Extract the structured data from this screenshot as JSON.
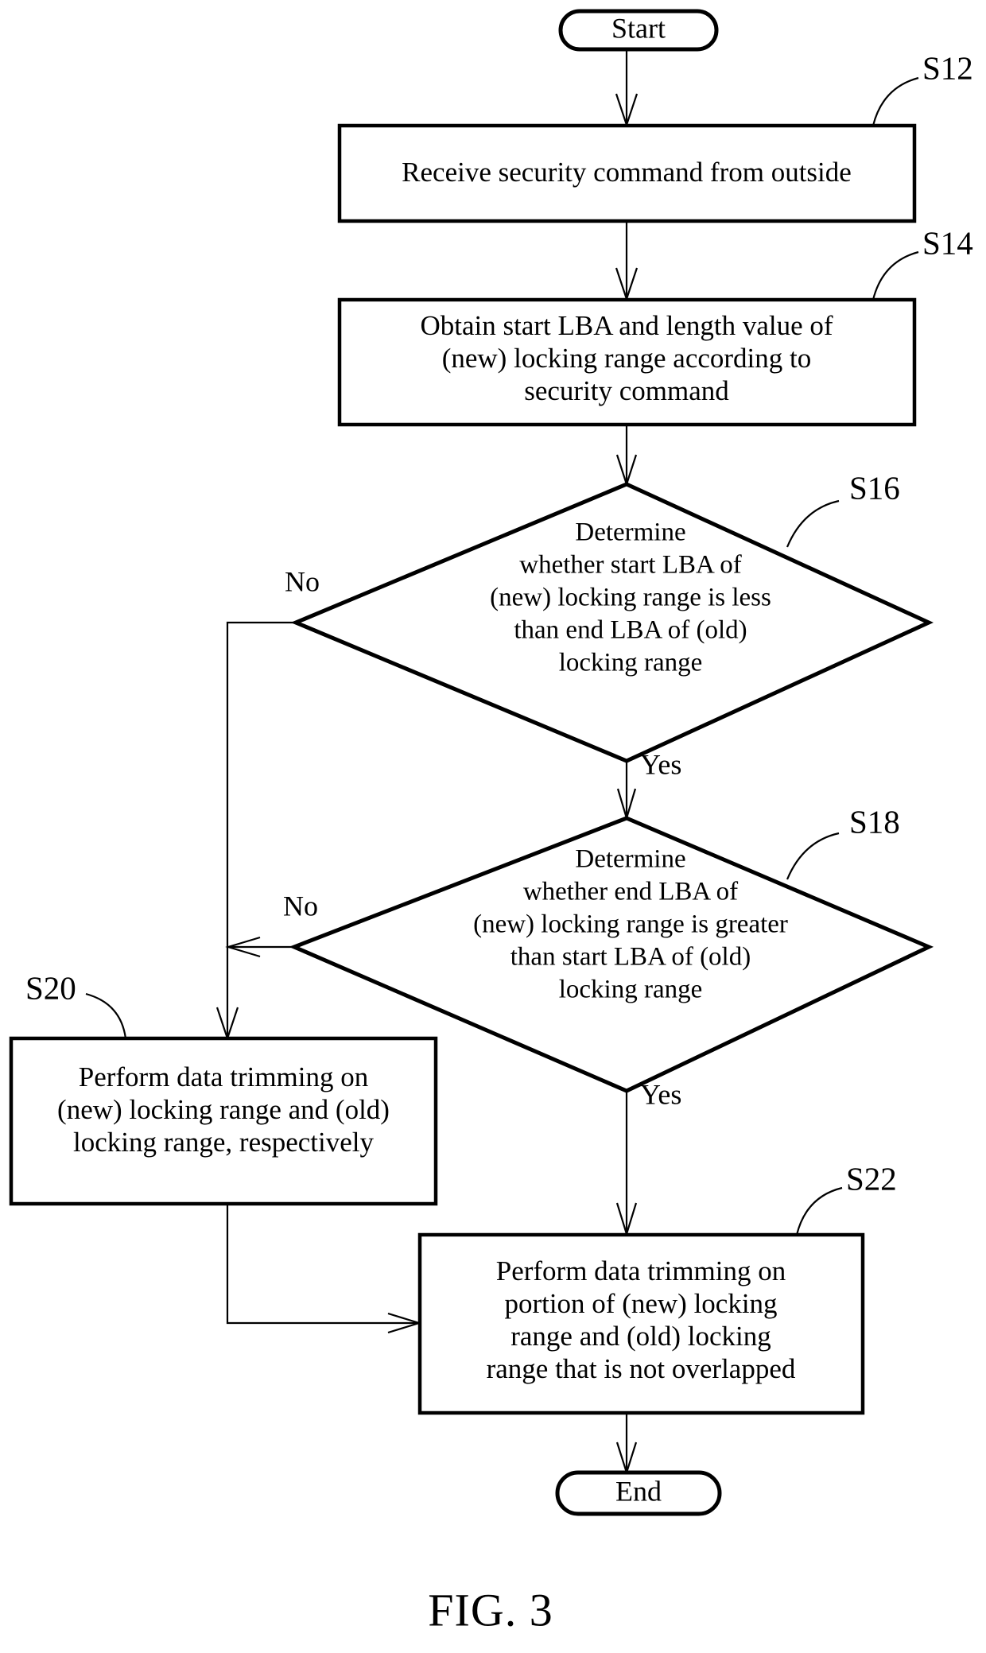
{
  "figure": {
    "caption": "FIG. 3",
    "type": "flowchart"
  },
  "nodes": {
    "start": {
      "label": "Start",
      "shape": "terminal"
    },
    "s12": {
      "ref": "S12",
      "shape": "process",
      "lines": [
        "Receive security command from outside"
      ]
    },
    "s14": {
      "ref": "S14",
      "shape": "process",
      "lines": [
        "Obtain start LBA and length value of",
        "(new) locking range according to",
        "security command"
      ]
    },
    "s16": {
      "ref": "S16",
      "shape": "decision",
      "lines": [
        "Determine",
        "whether start LBA of",
        "(new) locking range is less",
        "than end LBA of (old)",
        "locking range"
      ]
    },
    "s18": {
      "ref": "S18",
      "shape": "decision",
      "lines": [
        "Determine",
        "whether end LBA of",
        "(new) locking range is greater",
        "than start LBA of (old)",
        "locking range"
      ]
    },
    "s20": {
      "ref": "S20",
      "shape": "process",
      "lines": [
        "Perform data trimming on",
        "(new) locking range and (old)",
        "locking range, respectively"
      ]
    },
    "s22": {
      "ref": "S22",
      "shape": "process",
      "lines": [
        "Perform data trimming on",
        "portion of (new) locking",
        "range and (old) locking",
        "range that is not overlapped"
      ]
    },
    "end": {
      "label": "End",
      "shape": "terminal"
    }
  },
  "edges": {
    "s16_no": "No",
    "s16_yes": "Yes",
    "s18_no": "No",
    "s18_yes": "Yes"
  },
  "colors": {
    "stroke": "#000000",
    "fill": "#ffffff",
    "text": "#000000"
  }
}
